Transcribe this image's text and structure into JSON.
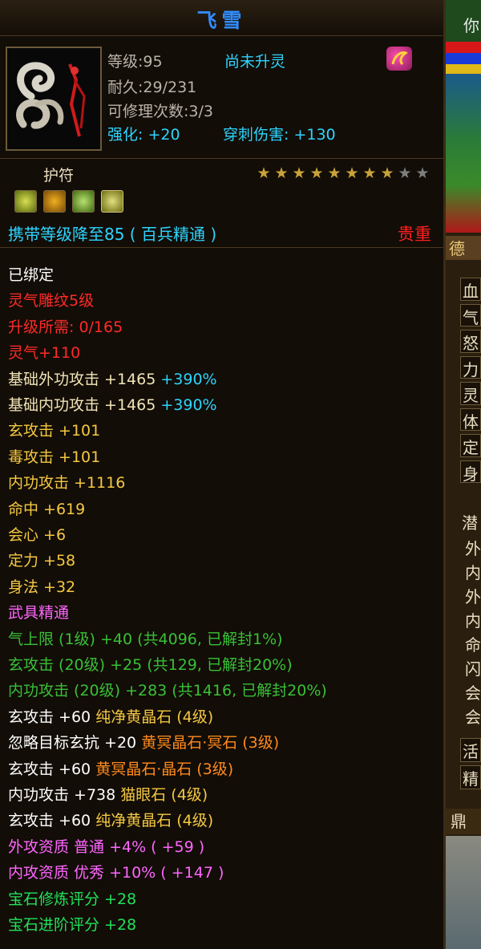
{
  "title": "飞雪",
  "header": {
    "level": "等级:95",
    "spirit_status": "尚未升灵",
    "durability": "耐久:29/231",
    "repair_count": "可修理次数:3/3",
    "enhance": "强化: +20",
    "pierce": "穿刺伤害: +130"
  },
  "type_label": "护符",
  "stars": {
    "filled": 8,
    "total": 10
  },
  "carry_text": "携带等级降至85 ( 百兵精通 )",
  "rarity": "贵重",
  "attributes": [
    {
      "parts": [
        {
          "text": "已绑定",
          "color": "#ffffff"
        }
      ]
    },
    {
      "parts": [
        {
          "text": "灵气雕纹5级",
          "color": "#ff2a2a"
        }
      ]
    },
    {
      "parts": [
        {
          "text": "升级所需: 0/165",
          "color": "#ff2a2a"
        }
      ]
    },
    {
      "parts": [
        {
          "text": "灵气+110",
          "color": "#ff2a2a"
        }
      ]
    },
    {
      "parts": [
        {
          "text": "基础外功攻击 +1465 ",
          "color": "#f2e4b8"
        },
        {
          "text": "+390%",
          "color": "#2ed4ff"
        }
      ]
    },
    {
      "parts": [
        {
          "text": "基础内功攻击 +1465 ",
          "color": "#f2e4b8"
        },
        {
          "text": "+390%",
          "color": "#2ed4ff"
        }
      ]
    },
    {
      "parts": [
        {
          "text": "玄攻击 +101",
          "color": "#f5c842"
        }
      ]
    },
    {
      "parts": [
        {
          "text": "毒攻击 +101",
          "color": "#f5c842"
        }
      ]
    },
    {
      "parts": [
        {
          "text": "内功攻击 +1116",
          "color": "#f5c842"
        }
      ]
    },
    {
      "parts": [
        {
          "text": "命中 +619",
          "color": "#f5c842"
        }
      ]
    },
    {
      "parts": [
        {
          "text": "会心 +6",
          "color": "#f5c842"
        }
      ]
    },
    {
      "parts": [
        {
          "text": "定力 +58",
          "color": "#f5c842"
        }
      ]
    },
    {
      "parts": [
        {
          "text": "身法 +32",
          "color": "#f5c842"
        }
      ]
    },
    {
      "parts": [
        {
          "text": "武具精通",
          "color": "#ff66ff"
        }
      ]
    },
    {
      "parts": [
        {
          "text": "气上限 (1级) +40 (共4096, 已解封1%)",
          "color": "#38c038"
        }
      ]
    },
    {
      "parts": [
        {
          "text": "玄攻击 (20级) +25 (共129, 已解封20%)",
          "color": "#38c038"
        }
      ]
    },
    {
      "parts": [
        {
          "text": "内功攻击 (20级) +283 (共1416, 已解封20%)",
          "color": "#38c038"
        }
      ]
    },
    {
      "parts": [
        {
          "text": "玄攻击 +60 ",
          "color": "#ffffff"
        },
        {
          "text": "纯净黄晶石 (4级)",
          "color": "#f5c842"
        }
      ]
    },
    {
      "parts": [
        {
          "text": "忽略目标玄抗 +20 ",
          "color": "#ffffff"
        },
        {
          "text": "黄冥晶石·冥石 (3级)",
          "color": "#ff8a1e"
        }
      ]
    },
    {
      "parts": [
        {
          "text": "玄攻击 +60 ",
          "color": "#ffffff"
        },
        {
          "text": "黄冥晶石·晶石 (3级)",
          "color": "#ff8a1e"
        }
      ]
    },
    {
      "parts": [
        {
          "text": "内功攻击 +738 ",
          "color": "#ffffff"
        },
        {
          "text": "猫眼石 (4级)",
          "color": "#f5c842"
        }
      ]
    },
    {
      "parts": [
        {
          "text": "玄攻击 +60 ",
          "color": "#ffffff"
        },
        {
          "text": "纯净黄晶石 (4级)",
          "color": "#f5c842"
        }
      ]
    },
    {
      "parts": [
        {
          "text": "外攻资质  普通 +4% ( +59 )",
          "color": "#ff66ff"
        }
      ]
    },
    {
      "parts": [
        {
          "text": "内攻资质  优秀 +10% ( +147 )",
          "color": "#ff66ff"
        }
      ]
    },
    {
      "parts": [
        {
          "text": "宝石修炼评分 +28",
          "color": "#22e05a"
        }
      ]
    },
    {
      "parts": [
        {
          "text": "宝石进阶评分 +28",
          "color": "#22e05a"
        }
      ]
    }
  ],
  "right_panel": {
    "top_char": "你",
    "tab_char": "德",
    "items": [
      "血",
      "气",
      "怒",
      "力",
      "灵",
      "体",
      "定",
      "身"
    ],
    "section": "潜",
    "subitems": [
      "外",
      "内",
      "外",
      "内",
      "命",
      "闪",
      "会",
      "会"
    ],
    "items2": [
      "活",
      "精"
    ],
    "bottom_char": "鼎"
  },
  "colors": {
    "title": "#2f8cff",
    "rarity": "#ff2020",
    "carry": "#2ed4ff",
    "gold": "#f5c842"
  }
}
